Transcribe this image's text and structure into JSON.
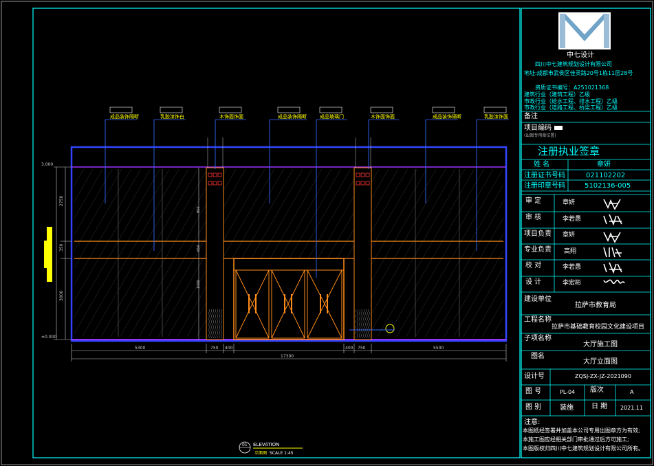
{
  "company": {
    "name_cn": "中七设计",
    "full_name": "四川中七建筑规划设计有限公司",
    "address": "地址:成都市武侯区佳灵路20号1栋11层28号",
    "cert": "资质证书编号：A251021368",
    "quals": [
      "建筑行业（建筑工程）乙级",
      "市政行业（给水工程、排水工程）乙级",
      "市政行业（道路工程、桥梁工程）乙级"
    ]
  },
  "remark_label": "备注",
  "project_no_label": "项目编码",
  "stamp_position": "(出图专用章位置)",
  "seal_header": "注册执业签章",
  "registry": {
    "rows": [
      {
        "label": "姓 名",
        "value": "章妍"
      },
      {
        "label": "注册证书号码",
        "value": "021102202"
      },
      {
        "label": "注册印章号码",
        "value": "5102136-005"
      }
    ]
  },
  "signers": [
    {
      "role": "审 定",
      "name": "章妍",
      "sign": "李斌"
    },
    {
      "role": "审 核",
      "name": "李若愚",
      "sign": "唐志艺"
    },
    {
      "role": "项目负责",
      "name": "章妍",
      "sign": "李斌"
    },
    {
      "role": "专业负责",
      "name": "高翔",
      "sign": "高翔"
    },
    {
      "role": "校 对",
      "name": "李若愚",
      "sign": "唐志艺"
    },
    {
      "role": "设 计",
      "name": "李宏彬",
      "sign": "李宏彬"
    }
  ],
  "client_label": "建设单位",
  "client": "拉萨市教育局",
  "project_label": "工程名称",
  "project": "拉萨市基础教育校园文化建设项目",
  "subitem_label": "子项名称",
  "subitem": "大厅施工图",
  "drawing_name_label": "图名",
  "drawing_name": "大厅立面图",
  "design_no_label": "设计号",
  "design_no": "ZQSJ-ZX-JZ-2021090",
  "drawing_no_label": "图 号",
  "drawing_no": "PL-04",
  "version_label": "版次",
  "version": "A",
  "category_label": "图 别",
  "category": "装施",
  "date_label": "日 期",
  "date": "2021.11",
  "notes_label": "注意:",
  "notes": [
    "本图纸经签署并加盖本公司专用出图章方为有效;",
    "本施工图应经相关部门审批通过后方可施工;",
    "本图版权归四川中七建筑规划设计有限公司所有。"
  ],
  "callouts": [
    "成品装饰隔断",
    "乳胶漆饰白",
    "木饰面饰面",
    "成品装饰隔断",
    "成品玻璃门",
    "木饰面饰面",
    "成品装饰隔断",
    "乳胶漆饰面"
  ],
  "dimensions": {
    "bottom_segments": [
      "5300",
      "750",
      "400",
      "400",
      "750",
      "5500"
    ],
    "bottom_total": "17300",
    "left_segments": [
      "2750",
      "350",
      "3000"
    ],
    "left_levels": [
      "3.000",
      "±0.000"
    ],
    "column_marks": [
      "950",
      "650",
      "1000"
    ]
  },
  "elevation": {
    "title": "ELEVATION",
    "subtitle": "立面图",
    "scale": "SCALE 1:45",
    "tag": "01"
  },
  "colors": {
    "frame": "#00ffff",
    "outline": "#3344ff",
    "hatch": "#555555",
    "wood": "#ff8c1a",
    "leader": "#3366ff",
    "dim": "#cccccc",
    "violet": "#9933ff",
    "yellow": "#ffff00",
    "white": "#ffffff",
    "red": "#ff3333"
  }
}
